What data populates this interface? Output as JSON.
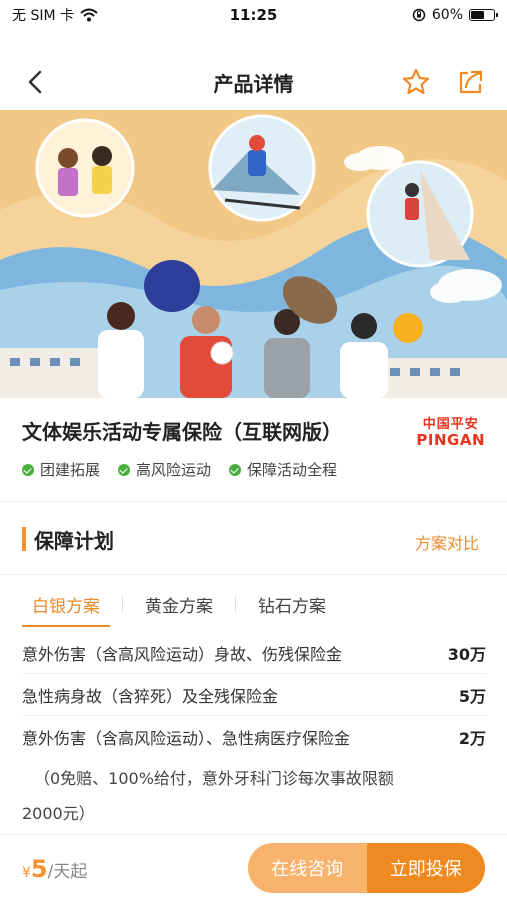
{
  "status_bar": {
    "carrier": "无 SIM 卡",
    "time": "11:25",
    "battery_percent": "60%",
    "battery_level": 0.6
  },
  "nav": {
    "title": "产品详情"
  },
  "product": {
    "name": "文体娱乐活动专属保险（互联网版）",
    "brand_cn": "中国平安",
    "brand_en": "PINGAN",
    "tags": [
      "团建拓展",
      "高风险运动",
      "保障活动全程"
    ]
  },
  "plan": {
    "section_title": "保障计划",
    "compare_label": "方案对比",
    "tabs": [
      "白银方案",
      "黄金方案",
      "钻石方案"
    ],
    "active_tab": 0,
    "rows": [
      {
        "label": "意外伤害（含高风险运动）身故、伤残保险金",
        "value": "30万"
      },
      {
        "label": "急性病身故（含猝死）及全残保险金",
        "value": "5万"
      },
      {
        "label": "意外伤害（含高风险运动）、急性病医疗保险金",
        "value": "2万"
      }
    ],
    "note_line1": "（0免赔、100%给付，意外牙科门诊每次事故限额",
    "note_line2": "2000元）"
  },
  "bottom": {
    "currency": "¥",
    "price": "5",
    "unit": "/天起",
    "consult_label": "在线咨询",
    "buy_label": "立即投保"
  },
  "colors": {
    "accent": "#ec8a2a",
    "check": "#4aad3e",
    "brand": "#e8341e"
  }
}
